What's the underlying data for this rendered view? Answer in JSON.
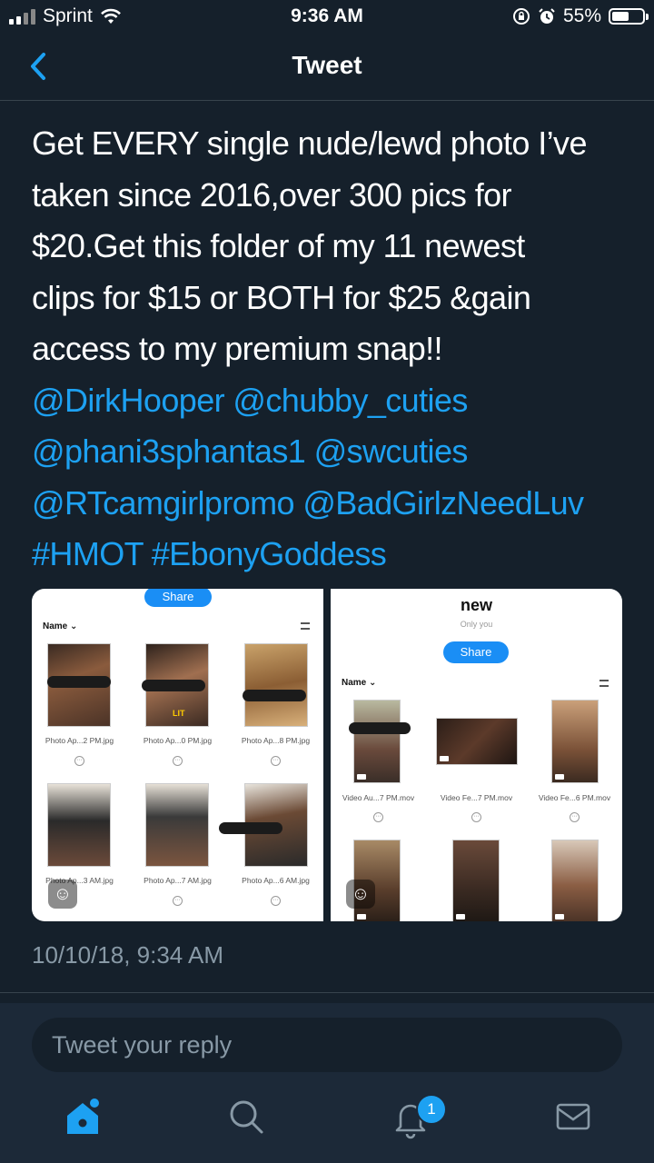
{
  "status": {
    "carrier": "Sprint",
    "time": "9:36 AM",
    "battery": "55%"
  },
  "nav": {
    "title": "Tweet"
  },
  "tweet": {
    "text_lines": [
      "Get EVERY single nude/lewd photo I’ve",
      "taken since 2016,over 300 pics for",
      "$20.Get this folder of my 11 newest",
      "clips for $15 or BOTH for $25 &gain",
      "access to my premium snap!!"
    ],
    "mentions_line1": [
      "@DirkHooper",
      "@chubby_cuties"
    ],
    "mentions_line2": [
      "@phani3sphantas1",
      "@swcuties"
    ],
    "mentions_line3": [
      "@RTcamgirlpromo",
      "@BadGirlzNeedLuv"
    ],
    "hashtags": [
      "#HMOT",
      "#EbonyGoddess"
    ],
    "timestamp": "10/10/18, 9:34 AM"
  },
  "media": {
    "left": {
      "share_label": "Share",
      "sort_label": "Name",
      "files": [
        "Photo Ap...2 PM.jpg",
        "Photo Ap...0 PM.jpg",
        "Photo Ap...8 PM.jpg",
        "Photo Ap...3 AM.jpg",
        "Photo Ap...7 AM.jpg",
        "Photo Ap...6 AM.jpg"
      ],
      "sticker_text": "LIT"
    },
    "right": {
      "folder_title": "new",
      "folder_subtitle": "Only you",
      "share_label": "Share",
      "sort_label": "Name",
      "files": [
        "Video Au...7 PM.mov",
        "Video Fe...7 PM.mov",
        "Video Fe...6 PM.mov"
      ]
    }
  },
  "reply": {
    "placeholder": "Tweet your reply"
  },
  "tabs": {
    "notifications_badge": "1"
  },
  "colors": {
    "background": "#15202b",
    "accent": "#1da1f2",
    "muted": "#8899a6"
  },
  "icons": [
    "back-chevron-icon",
    "home-icon",
    "search-icon",
    "bell-icon",
    "mail-icon",
    "wifi-icon",
    "alarm-icon",
    "rotation-lock-icon"
  ]
}
